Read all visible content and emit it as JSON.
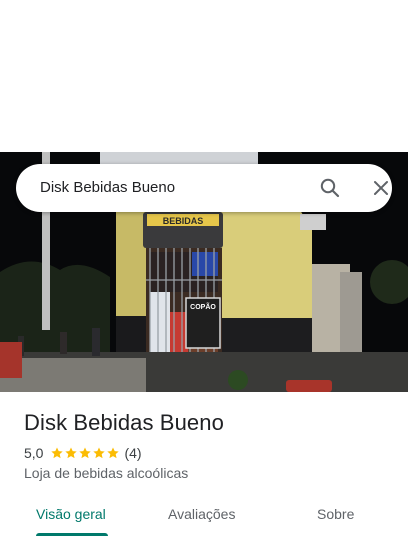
{
  "search": {
    "query": "Disk Bebidas Bueno",
    "search_icon": "search-icon",
    "close_icon": "close-icon"
  },
  "photo": {
    "sign_text": "BEBIDAS",
    "poster_text": "COPÃO"
  },
  "place": {
    "name": "Disk Bebidas Bueno",
    "rating": "5,0",
    "stars": 5,
    "review_count": "(4)",
    "category": "Loja de bebidas alcoólicas"
  },
  "tabs": [
    {
      "label": "Visão geral",
      "active": true
    },
    {
      "label": "Avaliações",
      "active": false
    },
    {
      "label": "Sobre",
      "active": false
    }
  ],
  "colors": {
    "accent": "#00796b",
    "star": "#fbbc04",
    "wall_yellow": "#d9cd7a"
  }
}
